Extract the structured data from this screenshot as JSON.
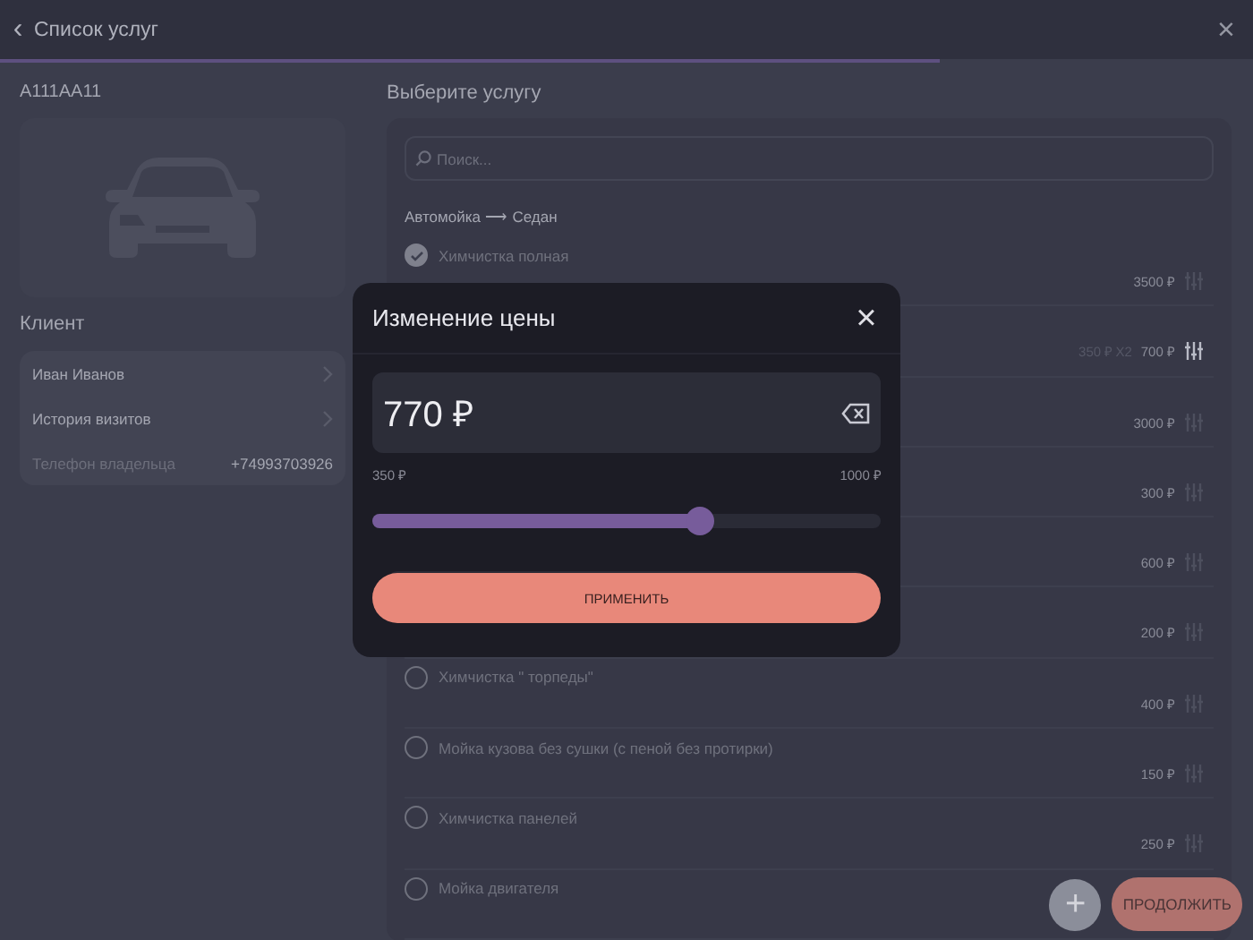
{
  "header": {
    "back": "‹",
    "title": "Список услуг",
    "close": "×",
    "progress": {
      "level": 0.75
    }
  },
  "vehicle": {
    "plate": "А111АА11"
  },
  "client": {
    "heading": "Клиент",
    "rows": [
      {
        "kind": "link",
        "label": "Иван Иванов"
      },
      {
        "kind": "link",
        "label": "История визитов"
      },
      {
        "kind": "info",
        "label": "Телефон владельца",
        "value": "+74993703926"
      }
    ]
  },
  "services": {
    "heading": "Выберите услугу",
    "search": {
      "placeholder": "Поиск..."
    },
    "breadcrumb": "Автомойка ⟶ Седан",
    "items": [
      {
        "name": "Химчистка полная",
        "checked": true,
        "price": "3500 ₽",
        "price_adjusted": false
      },
      {
        "note": "350 ₽ X2",
        "price": "700 ₽",
        "price_adjusted": true
      },
      {
        "price": "3000 ₽",
        "price_adjusted": false
      },
      {
        "price": "300 ₽",
        "price_adjusted": false
      },
      {
        "price": "600 ₽",
        "price_adjusted": false
      },
      {
        "price": "200 ₽",
        "price_adjusted": false
      },
      {
        "name": "Химчистка \" торпеды\"",
        "checked": false,
        "price": "400 ₽",
        "price_adjusted": false
      },
      {
        "name": "Мойка кузова без сушки (с пеной без протирки)",
        "checked": false,
        "price": "150 ₽",
        "price_adjusted": false
      },
      {
        "name": "Химчистка панелей",
        "checked": false,
        "price": "250 ₽",
        "price_adjusted": false
      },
      {
        "name": "Мойка двигателя",
        "checked": false
      }
    ]
  },
  "actions": {
    "add": "+",
    "continue": "ПРОДОЛЖИТЬ"
  },
  "dialog": {
    "title": "Изменение цены",
    "close": "×",
    "value": "770 ₽",
    "min": "350 ₽",
    "max": "1000 ₽",
    "slider": {
      "level": 0.646
    },
    "apply": "ПРИМЕНИТЬ"
  }
}
